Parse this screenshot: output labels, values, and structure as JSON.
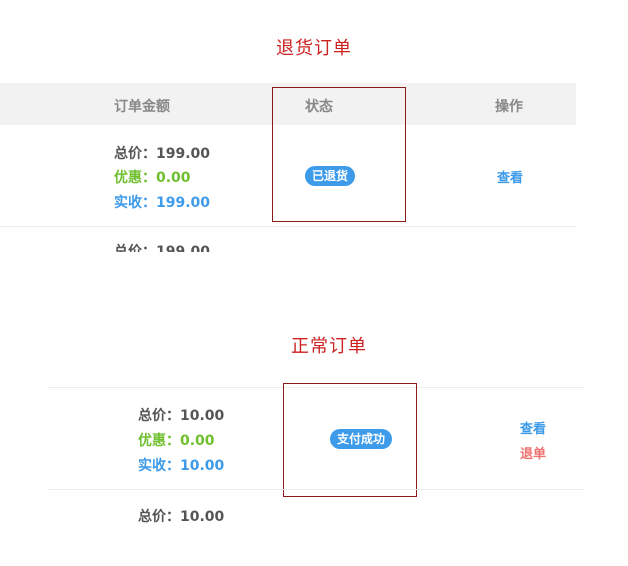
{
  "returned_section": {
    "title": "退货订单",
    "headers": {
      "amount": "订单金额",
      "status": "状态",
      "action": "操作"
    },
    "order": {
      "total_label": "总价：",
      "total_value": "199.00",
      "discount_label": "优惠：",
      "discount_value": "0.00",
      "received_label": "实收：",
      "received_value": "199.00",
      "status_badge": "已退货",
      "view_label": "查看"
    },
    "next_order": {
      "total_label": "总价：",
      "total_value": "199.00"
    }
  },
  "normal_section": {
    "title": "正常订单",
    "order": {
      "total_label": "总价：",
      "total_value": "10.00",
      "discount_label": "优惠：",
      "discount_value": "0.00",
      "received_label": "实收：",
      "received_value": "10.00",
      "status_badge": "支付成功",
      "view_label": "查看",
      "refund_label": "退单"
    },
    "next_order": {
      "total_label": "总价：",
      "total_value": "10.00"
    }
  },
  "colors": {
    "title_red": "#cc2222",
    "accent_blue": "#3d9be9",
    "discount_green": "#6fbf2f",
    "refund_red": "#f07070",
    "highlight_border": "#8b1a1a"
  }
}
